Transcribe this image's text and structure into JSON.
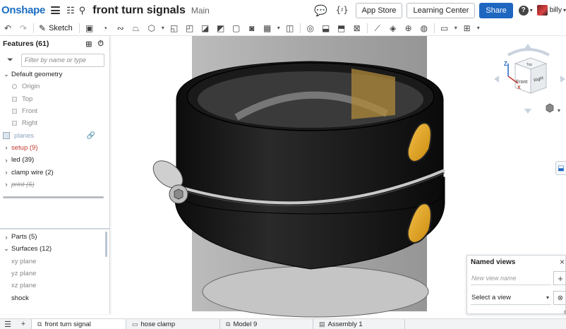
{
  "header": {
    "logo": "Onshape",
    "title": "front turn signals",
    "workspace": "Main",
    "app_store": "App Store",
    "learning_center": "Learning Center",
    "share": "Share",
    "help": "?",
    "user": "billy"
  },
  "toolbar": {
    "sketch_label": "Sketch"
  },
  "features": {
    "title": "Features (61)",
    "filter_placeholder": "Filter by name or type",
    "default_geometry": "Default geometry",
    "origin": "Origin",
    "top": "Top",
    "front": "Front",
    "right": "Right",
    "planes": "planes",
    "folders": [
      {
        "label": "setup (9)",
        "style": "error"
      },
      {
        "label": "led (39)",
        "style": "normal"
      },
      {
        "label": "clamp wire (2)",
        "style": "normal"
      },
      {
        "label": "print (6)",
        "style": "suppressed"
      }
    ]
  },
  "parts": {
    "parts_label": "Parts (5)",
    "surfaces_label": "Surfaces (12)",
    "surfaces": [
      "xy plane",
      "yz plane",
      "xz plane",
      "shock"
    ]
  },
  "viewcube": {
    "axis_z": "Z",
    "axis_x": "X",
    "top": "Top",
    "front": "Front",
    "right": "Right"
  },
  "named_views": {
    "title": "Named views",
    "input_placeholder": "New view name",
    "select_value": "Select a view"
  },
  "tabs": [
    {
      "label": "front turn signal",
      "active": true
    },
    {
      "label": "hose clamp",
      "active": false
    },
    {
      "label": "Model 9",
      "active": false
    },
    {
      "label": "Assembly 1",
      "active": false
    }
  ],
  "colors": {
    "brand": "#1b6ec2",
    "share": "#1f66c1",
    "error": "#c0392b",
    "led_amber": "#e8a317"
  }
}
